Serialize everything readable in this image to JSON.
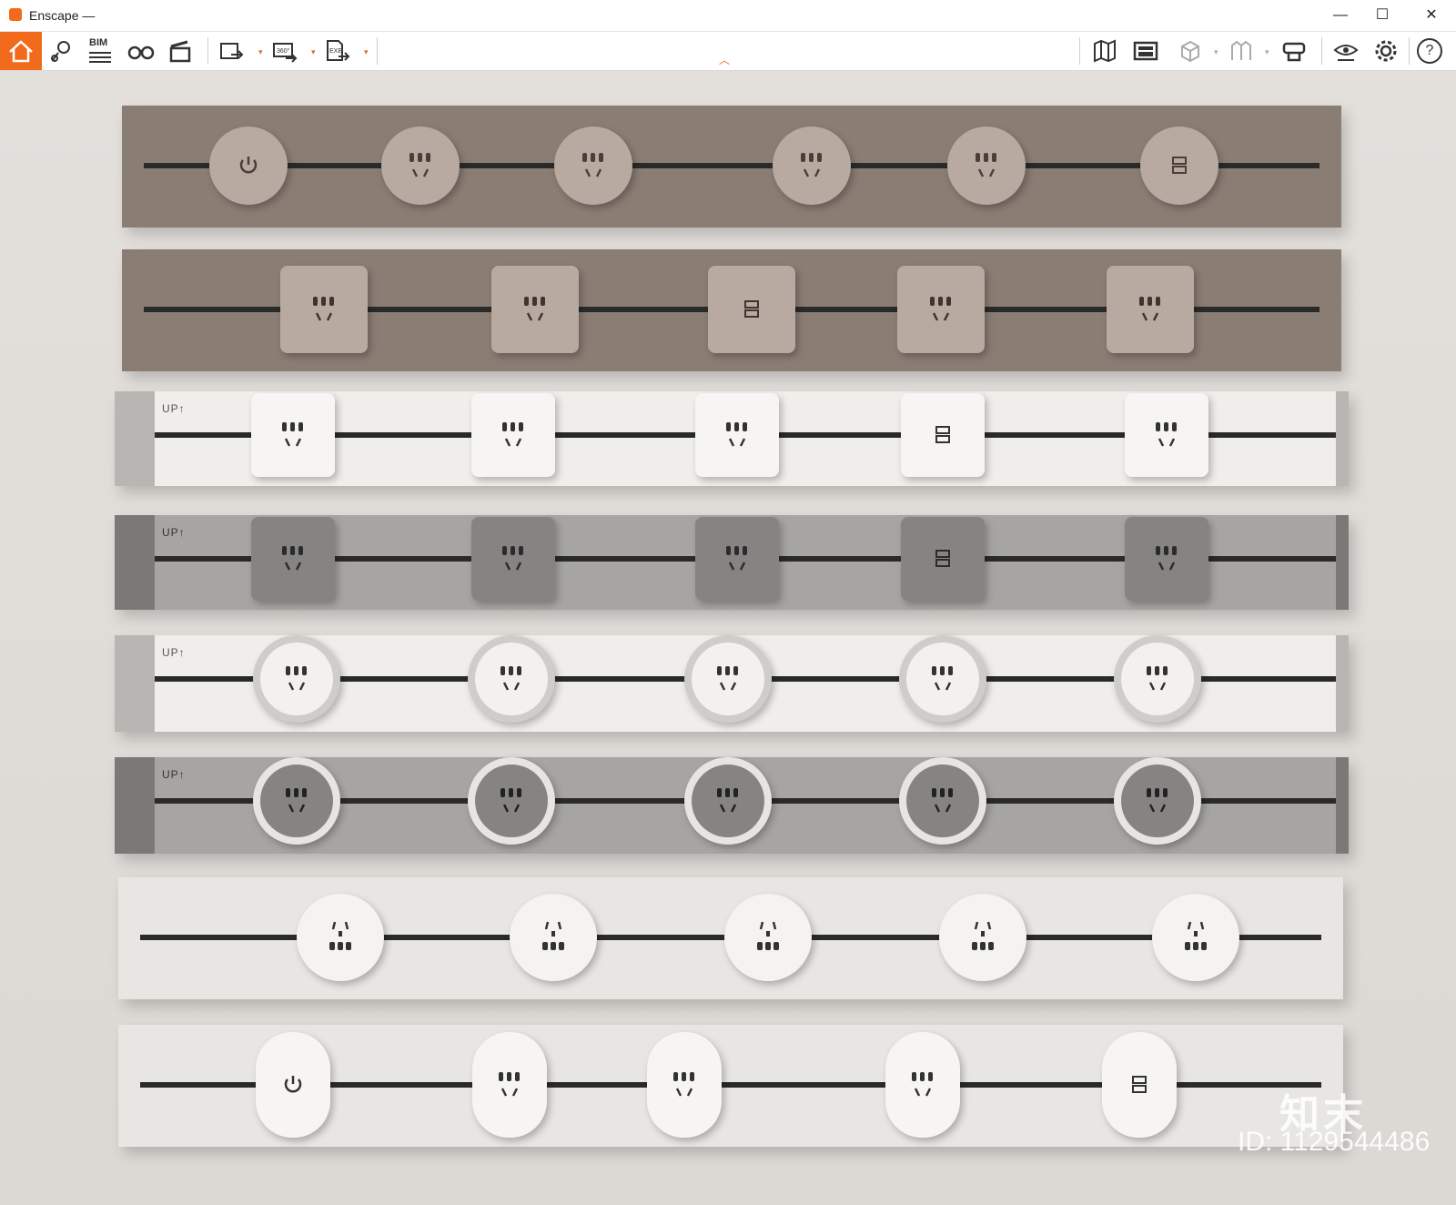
{
  "window": {
    "title": "Enscape —",
    "minimize": "—",
    "maximize": "☐",
    "close": "✕"
  },
  "toolbar": {
    "left_icons": [
      "home-icon",
      "location-pin-icon",
      "bim-icon",
      "binoculars-icon",
      "clapperboard-icon",
      "screenshot-export-icon",
      "panorama-360-export-icon",
      "exe-export-icon"
    ],
    "bim_label": "BIM",
    "pano_label": "360°",
    "exe_label": "EXE",
    "right_icons": [
      "map-icon",
      "asset-library-icon",
      "cube-icon",
      "views-icon",
      "vr-headset-icon",
      "visual-settings-icon",
      "settings-gear-icon",
      "help-icon"
    ],
    "help_label": "?"
  },
  "scene": {
    "up_label": "UP↑",
    "watermark_brand": "知末",
    "watermark_id": "ID: 1129544486",
    "colors": {
      "taupe": "#8a7d74",
      "taupe_socket": "#b8aaa0",
      "white": "#efeeeb",
      "gray": "#a6a5a3",
      "gray_socket": "#858482",
      "cream": "#e8e6e2",
      "accent": "#f26a1b"
    }
  }
}
